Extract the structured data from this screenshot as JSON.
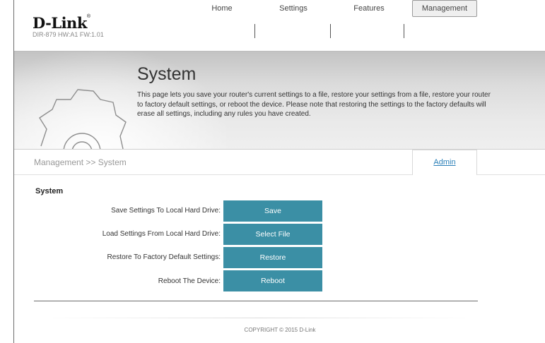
{
  "header": {
    "brand": "D-Link",
    "trademark": "®",
    "model_info": "DIR-879 HW:A1 FW:1.01"
  },
  "nav": {
    "items": [
      {
        "label": "Home"
      },
      {
        "label": "Settings"
      },
      {
        "label": "Features"
      },
      {
        "label": "Management",
        "active": true
      }
    ]
  },
  "hero": {
    "title": "System",
    "description": "This page lets you save your router's current settings to a file, restore your settings from a file, restore your router to factory default settings, or reboot the device. Please note that restoring the settings to the factory defaults will erase all settings, including any rules you have created.",
    "icon": "gear-icon"
  },
  "breadcrumb": {
    "text": "Management >> System",
    "admin_tab": "Admin"
  },
  "section": {
    "title": "System",
    "rows": [
      {
        "label": "Save Settings To Local Hard Drive:",
        "button": "Save"
      },
      {
        "label": "Load Settings From Local Hard Drive:",
        "button": "Select File"
      },
      {
        "label": "Restore To Factory Default Settings:",
        "button": "Restore"
      },
      {
        "label": "Reboot The Device:",
        "button": "Reboot"
      }
    ]
  },
  "footer": {
    "copyright": "COPYRIGHT © 2015 D-Link"
  },
  "colors": {
    "accent": "#3b8fa5",
    "link": "#2a7fb8"
  }
}
